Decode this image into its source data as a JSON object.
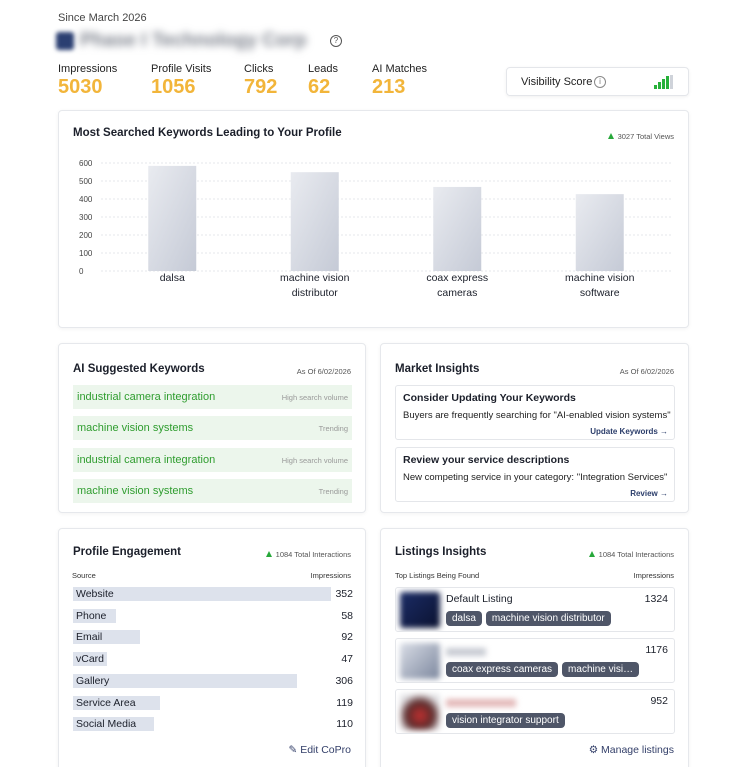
{
  "header": {
    "since": "Since March 2026",
    "company_name": "Phase I Technology Corp"
  },
  "stats": [
    {
      "label": "Impressions",
      "value": "5030"
    },
    {
      "label": "Profile Visits",
      "value": "1056"
    },
    {
      "label": "Clicks",
      "value": "792"
    },
    {
      "label": "Leads",
      "value": "62"
    },
    {
      "label": "AI Matches",
      "value": "213"
    }
  ],
  "visibility": {
    "label": "Visibility Score",
    "signal_level": 1.0
  },
  "keywords_chart": {
    "title": "Most Searched Keywords Leading to Your Profile",
    "total": "3027 Total Views"
  },
  "chart_data": {
    "type": "bar",
    "categories": [
      [
        "dalsa"
      ],
      [
        "machine vision",
        "distributor"
      ],
      [
        "coax express",
        "cameras"
      ],
      [
        "machine vision",
        "software"
      ]
    ],
    "values": [
      584,
      549,
      467,
      427
    ],
    "ylim": [
      0,
      600
    ],
    "yticks": [
      0,
      100,
      200,
      300,
      400,
      500,
      600
    ],
    "grid": true
  },
  "ai_keywords": {
    "title": "AI Suggested Keywords",
    "as_of": "As Of 6/02/2026",
    "items": [
      {
        "text": "industrial camera integration",
        "status": "High search volume"
      },
      {
        "text": "machine vision systems",
        "status": "Trending"
      },
      {
        "text": "industrial camera integration",
        "status": "High search volume"
      },
      {
        "text": "machine vision systems",
        "status": "Trending"
      }
    ]
  },
  "market": {
    "title": "Market Insights",
    "as_of": "As Of 6/02/2026",
    "items": [
      {
        "heading": "Consider Updating Your Keywords",
        "desc": "Buyers are frequently searching for \"AI-enabled vision systems\"",
        "action": "Update Keywords →"
      },
      {
        "heading": "Review your service descriptions",
        "desc": "New competing service in your category: \"Integration Services\"",
        "action": "Review →"
      }
    ]
  },
  "engagement": {
    "title": "Profile Engagement",
    "total": "1084 Total Interactions",
    "col_source": "Source",
    "col_impr": "Impressions",
    "rows": [
      {
        "name": "Website",
        "value": 352
      },
      {
        "name": "Phone",
        "value": 58
      },
      {
        "name": "Email",
        "value": 92
      },
      {
        "name": "vCard",
        "value": 47
      },
      {
        "name": "Gallery",
        "value": 306
      },
      {
        "name": "Service Area",
        "value": 119
      },
      {
        "name": "Social Media",
        "value": 110
      }
    ],
    "edit": "Edit CoPro"
  },
  "listings": {
    "title": "Listings Insights",
    "total": "1084 Total Interactions",
    "col_top": "Top Listings Being Found",
    "col_impr": "Impressions",
    "items": [
      {
        "title": "Default Listing",
        "count": "1324",
        "tags": [
          "dalsa",
          "machine vision distributor"
        ]
      },
      {
        "title": "",
        "count": "1176",
        "tags": [
          "coax express cameras",
          "machine visi…"
        ]
      },
      {
        "title": "",
        "count": "952",
        "tags": [
          "vision integrator support"
        ]
      }
    ],
    "manage": "Manage listings"
  }
}
